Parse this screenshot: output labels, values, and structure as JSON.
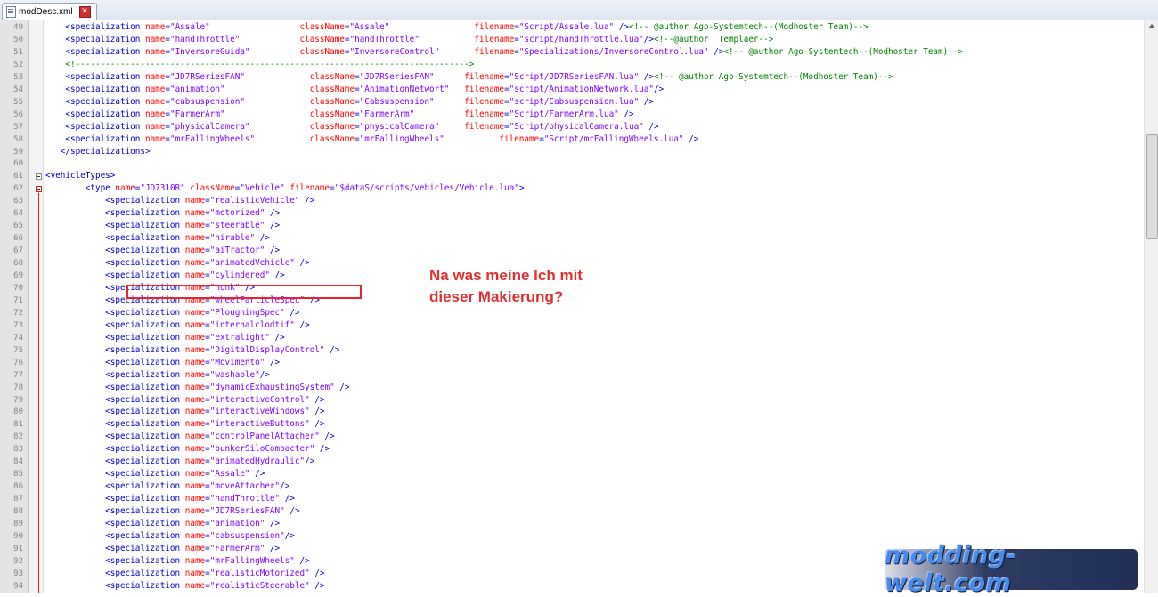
{
  "tab": {
    "label": "modDesc.xml",
    "close_icon": "close-icon"
  },
  "annotation": {
    "line1": "Na was meine Ich mit",
    "line2": "dieser Makierung?"
  },
  "watermark": "modding-welt.com",
  "colors": {
    "tag": "#0000c8",
    "attribute": "#ff0000",
    "value": "#8000ff",
    "comment": "#008000",
    "highlight": "#e8232a"
  },
  "lines": [
    {
      "n": "49",
      "code": "    <specialization name=\"Assale\"                  className=\"Assale\"                 filename=\"Script/Assale.lua\" /><!-- @author Ago-Systemtech--(Modhoster Team)-->"
    },
    {
      "n": "50",
      "code": "    <specialization name=\"handThrottle\"            className=\"handThrottle\"           filename=\"script/handThrottle.lua\"/><!--@author  Templaer-->"
    },
    {
      "n": "51",
      "code": "    <specialization name=\"InversoreGuida\"          className=\"InversoreControl\"       filename=\"Specializations/InversoreControl.lua\" /><!-- @author Ago-Systemtech--(Modhoster Team)-->"
    },
    {
      "n": "52",
      "code": "    <!------------------------------------------------------------------------------->"
    },
    {
      "n": "53",
      "code": "    <specialization name=\"JD7RSeriesFAN\"             className=\"JD7RSeriesFAN\"      filename=\"Script/JD7RSeriesFAN.lua\" /><!-- @author Ago-Systemtech--(Modhoster Team)-->"
    },
    {
      "n": "54",
      "code": "    <specialization name=\"animation\"                 className=\"AnimationNetwort\"   filename=\"script/AnimationNetwork.lua\"/>"
    },
    {
      "n": "55",
      "code": "    <specialization name=\"cabsuspension\"             className=\"Cabsuspension\"      filename=\"script/Cabsuspension.lua\" />"
    },
    {
      "n": "56",
      "code": "    <specialization name=\"FarmerArm\"                 className=\"FarmerArm\"          filename=\"Script/FarmerArm.lua\" />"
    },
    {
      "n": "57",
      "code": "    <specialization name=\"physicalCamera\"            className=\"physicalCamera\"     filename=\"Script/physicalCamera.lua\" />"
    },
    {
      "n": "58",
      "code": "    <specialization name=\"mrFallingWheels\"           className=\"mrFallingWheels\"           filename=\"Script/mrFallingWheels.lua\" />"
    },
    {
      "n": "59",
      "code": "   </specializations>"
    },
    {
      "n": "60",
      "code": ""
    },
    {
      "n": "61",
      "code": "<vehicleTypes>"
    },
    {
      "n": "62",
      "code": "        <type name=\"JD7310R\" className=\"Vehicle\" filename=\"$dataS/scripts/vehicles/Vehicle.lua\">"
    },
    {
      "n": "63",
      "code": "            <specialization name=\"realisticVehicle\" />"
    },
    {
      "n": "64",
      "code": "            <specialization name=\"motorized\" />"
    },
    {
      "n": "65",
      "code": "            <specialization name=\"steerable\" />"
    },
    {
      "n": "66",
      "code": "            <specialization name=\"hirable\" />"
    },
    {
      "n": "67",
      "code": "            <specialization name=\"aiTractor\" />"
    },
    {
      "n": "68",
      "code": "            <specialization name=\"animatedVehicle\" />"
    },
    {
      "n": "69",
      "code": "            <specialization name=\"cylindered\" />"
    },
    {
      "n": "70",
      "code": "            <specialization name=\"honk\" />"
    },
    {
      "n": "71",
      "code": "            <specialization name=\"wheelParticleSpec\" />"
    },
    {
      "n": "72",
      "code": "            <specialization name=\"PloughingSpec\" />"
    },
    {
      "n": "73",
      "code": "            <specialization name=\"internalclodtif\" />"
    },
    {
      "n": "74",
      "code": "            <specialization name=\"extralight\" />"
    },
    {
      "n": "75",
      "code": "            <specialization name=\"DigitalDisplayControl\" />"
    },
    {
      "n": "76",
      "code": "            <specialization name=\"Movimento\" />"
    },
    {
      "n": "77",
      "code": "            <specialization name=\"washable\"/>"
    },
    {
      "n": "78",
      "code": "            <specialization name=\"dynamicExhaustingSystem\" />"
    },
    {
      "n": "79",
      "code": "            <specialization name=\"interactiveControl\" />"
    },
    {
      "n": "80",
      "code": "            <specialization name=\"interactiveWindows\" />"
    },
    {
      "n": "81",
      "code": "            <specialization name=\"interactiveButtons\" />"
    },
    {
      "n": "82",
      "code": "            <specialization name=\"controlPanelAttacher\" />"
    },
    {
      "n": "83",
      "code": "            <specialization name=\"bunkerSiloCompacter\" />"
    },
    {
      "n": "84",
      "code": "            <specialization name=\"animatedHydraulic\"/>"
    },
    {
      "n": "85",
      "code": "            <specialization name=\"Assale\" />"
    },
    {
      "n": "86",
      "code": "            <specialization name=\"moveAttacher\"/>"
    },
    {
      "n": "87",
      "code": "            <specialization name=\"handThrottle\" />"
    },
    {
      "n": "88",
      "code": "            <specialization name=\"JD7RSeriesFAN\" />"
    },
    {
      "n": "89",
      "code": "            <specialization name=\"animation\" />"
    },
    {
      "n": "90",
      "code": "            <specialization name=\"cabsuspension\"/>"
    },
    {
      "n": "91",
      "code": "            <specialization name=\"FarmerArm\" />"
    },
    {
      "n": "92",
      "code": "            <specialization name=\"mrFallingWheels\" />"
    },
    {
      "n": "93",
      "code": "            <specialization name=\"realisticMotorized\" />"
    },
    {
      "n": "94",
      "code": "            <specialization name=\"realisticSteerable\" />"
    }
  ]
}
